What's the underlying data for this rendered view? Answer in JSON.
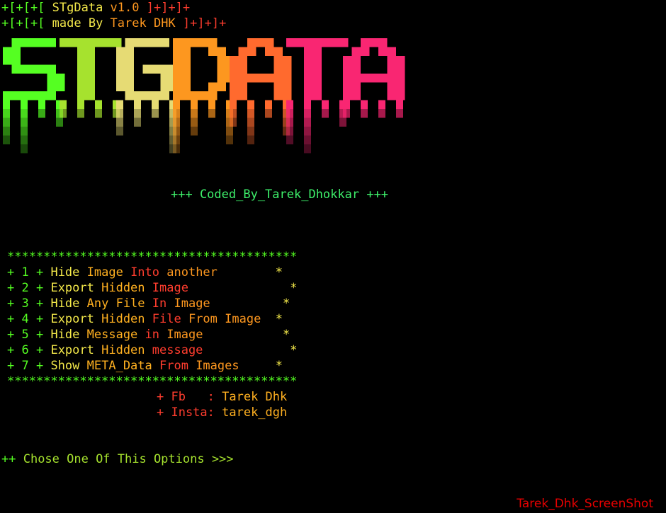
{
  "header": {
    "line1": {
      "prefix": "+[+[+[ ",
      "name": "STgData",
      "version": " v1.0",
      "suffix": " ]+]+]+"
    },
    "line2": {
      "prefix": "+[+[+[ ",
      "made": "made By",
      "author": " Tarek DHK",
      "suffix": " ]+]+]+"
    }
  },
  "logo": {
    "colors": [
      "#55ff22",
      "#a6e22e",
      "#e6db74",
      "#fd971f",
      "#ff6a2e",
      "#f92672"
    ]
  },
  "coded_by": "+++ Coded_By_Tarek_Dhokkar +++",
  "menu": {
    "border": "****************************************",
    "items": [
      {
        "num": "1",
        "a": "Hide",
        "b": " Image",
        "c": " Into",
        "d": " another",
        "pad": "        "
      },
      {
        "num": "2",
        "a": "Export",
        "b": " Hidden",
        "c": " Image",
        "d": "",
        "pad": "              "
      },
      {
        "num": "3",
        "a": "Hide",
        "b": " Any File",
        "c": " In",
        "d": " Image",
        "pad": "          "
      },
      {
        "num": "4",
        "a": "Export",
        "b": " Hidden",
        "c": " File",
        "d": " From Image",
        "pad": "  "
      },
      {
        "num": "5",
        "a": "Hide",
        "b": " Message",
        "c": " in",
        "d": " Image",
        "pad": "           "
      },
      {
        "num": "6",
        "a": "Export",
        "b": " Hidden",
        "c": " message",
        "d": "",
        "pad": "            "
      },
      {
        "num": "7",
        "a": "Show",
        "b": " META_Data",
        "c": " From",
        "d": " Images",
        "pad": "     "
      }
    ],
    "end": "*"
  },
  "social": {
    "fb_label": "+ Fb   :",
    "fb_value": " Tarek Dhk",
    "insta_label": "+ Insta:",
    "insta_value": " tarek_dgh"
  },
  "prompt": {
    "pre": "++ ",
    "text": "Chose One Of This Options >>>"
  },
  "watermark": "Tarek_Dhk_ScreenShot"
}
